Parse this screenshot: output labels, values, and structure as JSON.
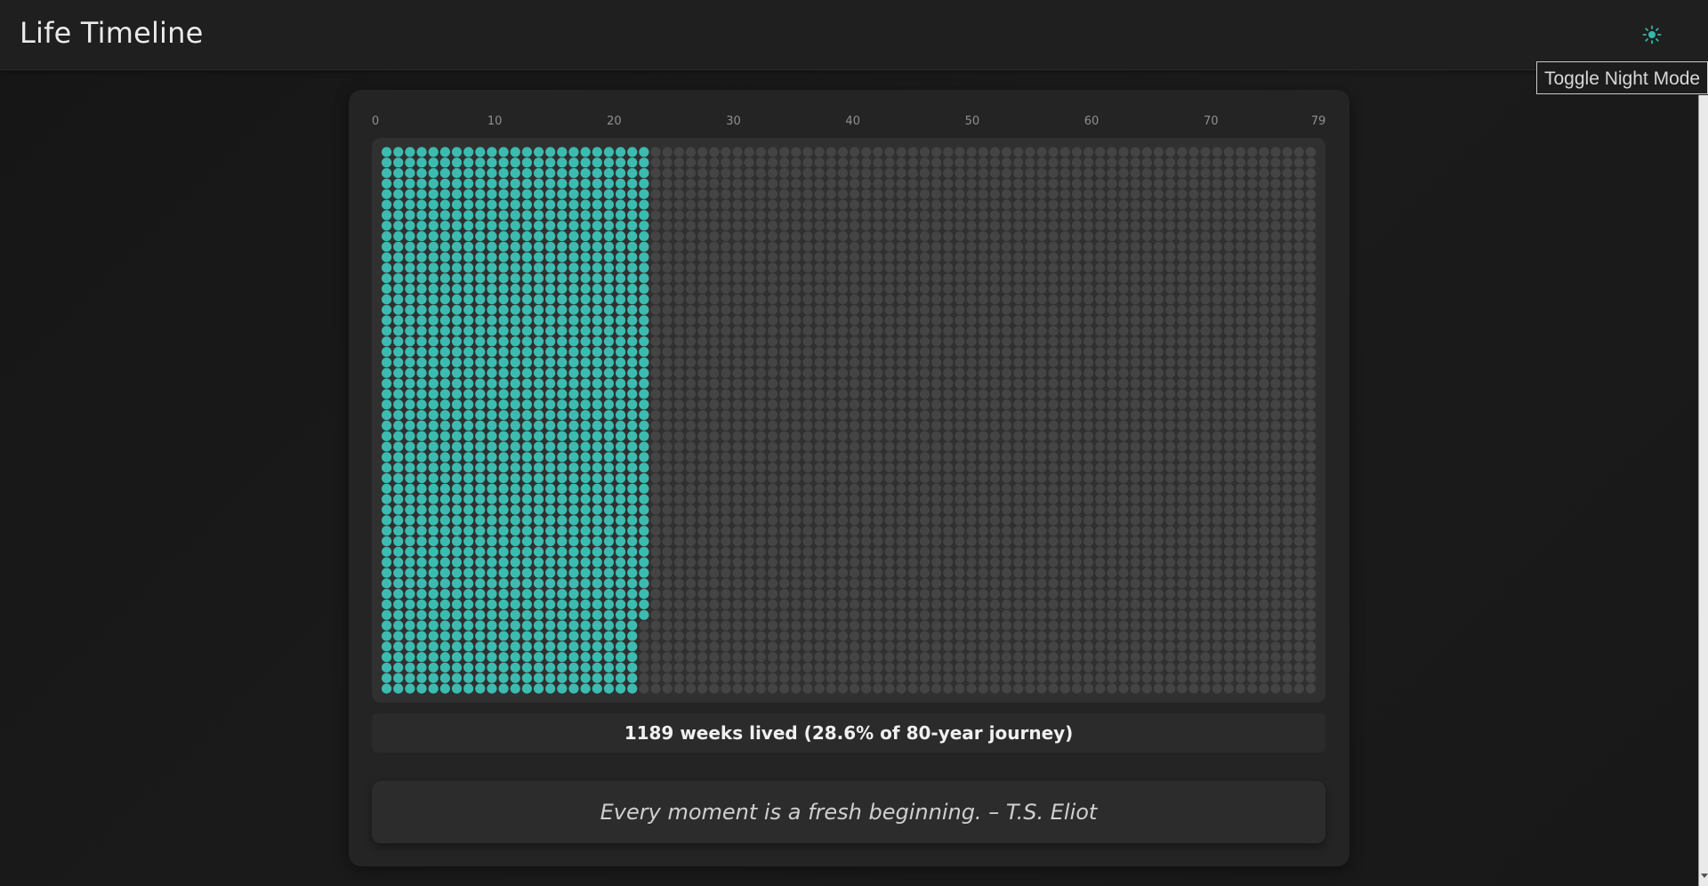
{
  "header": {
    "title": "Life Timeline",
    "theme_toggle_icon": "sun-icon",
    "tooltip": "Toggle Night Mode"
  },
  "timeline": {
    "axis_labels": [
      "0",
      "10",
      "20",
      "30",
      "40",
      "50",
      "60",
      "70",
      "79"
    ],
    "total_years": 80,
    "weeks_per_year": 52,
    "weeks_lived": 1189,
    "lived_color": "#3cbcb0",
    "remaining_color": "#444444"
  },
  "stats": {
    "text": "1189 weeks lived (28.6% of 80-year journey)"
  },
  "quote": {
    "text": "Every moment is a fresh beginning. – T.S. Eliot"
  }
}
